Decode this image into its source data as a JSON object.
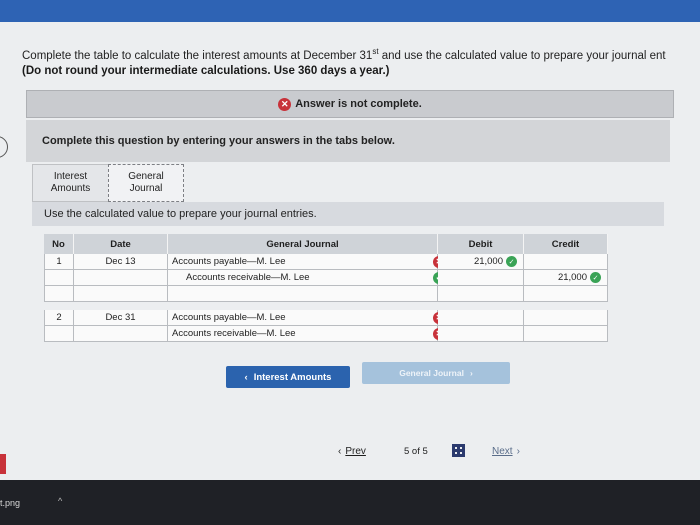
{
  "prompt": {
    "line1_before_sup": "Complete the table to calculate the interest amounts at December 31",
    "line1_sup": "st",
    "line1_after_sup": " and use the calculated value to prepare your journal ent",
    "line2": "(Do not round your intermediate calculations. Use 360 days a year.)"
  },
  "banner": {
    "icon": "x-icon",
    "text": "Answer is not complete."
  },
  "complete_box": "Complete this question by entering your answers in the tabs below.",
  "tabs": [
    {
      "label1": "Interest",
      "label2": "Amounts"
    },
    {
      "label1": "General",
      "label2": "Journal"
    }
  ],
  "instructions": "Use the calculated value to prepare your journal entries.",
  "journal": {
    "headers": {
      "no": "No",
      "date": "Date",
      "account": "General Journal",
      "debit": "Debit",
      "credit": "Credit"
    },
    "rows": [
      {
        "no": "1",
        "date": "Dec 13",
        "account": "Accounts payable—M. Lee",
        "debit": "21,000",
        "credit": "",
        "mark": "bad"
      },
      {
        "no": "",
        "date": "",
        "account": "Accounts receivable—M. Lee",
        "debit": "",
        "credit": "21,000",
        "mark": "ok"
      },
      {
        "no": "",
        "date": "",
        "account": "",
        "debit": "",
        "credit": "",
        "mark": ""
      },
      {
        "no": "2",
        "date": "Dec 31",
        "account": "Accounts payable—M. Lee",
        "debit": "",
        "credit": "",
        "mark": "bad"
      },
      {
        "no": "",
        "date": "",
        "account": "Accounts receivable—M. Lee",
        "debit": "",
        "credit": "",
        "mark": "bad"
      }
    ]
  },
  "buttons": {
    "prev_tab": "Interest Amounts",
    "next_tab": "General Journal"
  },
  "pager": {
    "prev": "Prev",
    "indicator": "5 of 5",
    "next": "Next"
  },
  "taskbar": {
    "file": "t.png"
  }
}
